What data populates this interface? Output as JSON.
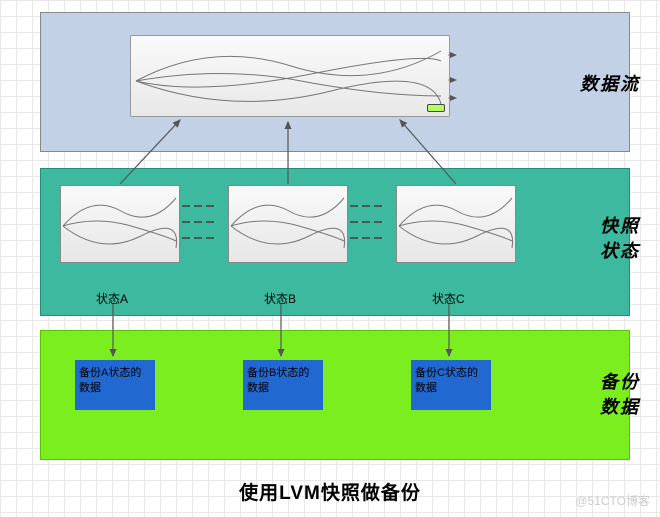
{
  "labels": {
    "stream": "数据流",
    "snapshot_line1": "快照",
    "snapshot_line2": "状态",
    "backup_line1": "备份",
    "backup_line2": "数据"
  },
  "snapshots": {
    "a": "状态A",
    "b": "状态B",
    "c": "状态C"
  },
  "backups": {
    "a": "备份A状态的数据",
    "b": "备份B状态的数据",
    "c": "备份C状态的数据"
  },
  "caption": "使用LVM快照做备份",
  "watermark": "@51CTO博客"
}
